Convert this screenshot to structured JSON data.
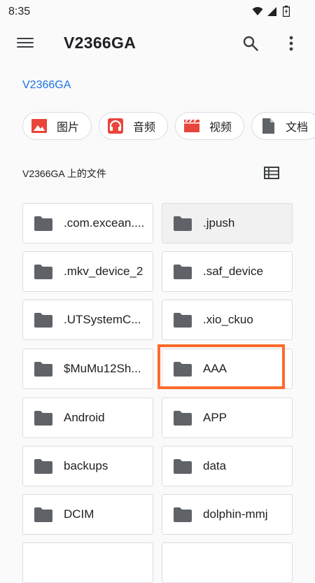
{
  "status_bar": {
    "time": "8:35"
  },
  "app_bar": {
    "title": "V2366GA"
  },
  "breadcrumb": {
    "label": "V2366GA"
  },
  "chips": [
    {
      "label": "图片",
      "icon": "image-icon",
      "color": "#e8453c"
    },
    {
      "label": "音频",
      "icon": "headphones-icon",
      "color": "#e8453c"
    },
    {
      "label": "视频",
      "icon": "video-icon",
      "color": "#e8453c"
    },
    {
      "label": "文档",
      "icon": "document-icon",
      "color": "#5f6368"
    }
  ],
  "section": {
    "title": "V2366GA 上的文件"
  },
  "folders": [
    {
      "name": ".com.excean...."
    },
    {
      "name": ".jpush"
    },
    {
      "name": ".mkv_device_2"
    },
    {
      "name": ".saf_device"
    },
    {
      "name": ".UTSystemC..."
    },
    {
      "name": ".xio_ckuo"
    },
    {
      "name": "$MuMu12Sh..."
    },
    {
      "name": "AAA"
    },
    {
      "name": "Android"
    },
    {
      "name": "APP"
    },
    {
      "name": "backups"
    },
    {
      "name": "data"
    },
    {
      "name": "DCIM"
    },
    {
      "name": "dolphin-mmj"
    }
  ],
  "colors": {
    "accent": "#1a73e8",
    "highlight": "#ff6a2b",
    "folder": "#5f6368"
  }
}
